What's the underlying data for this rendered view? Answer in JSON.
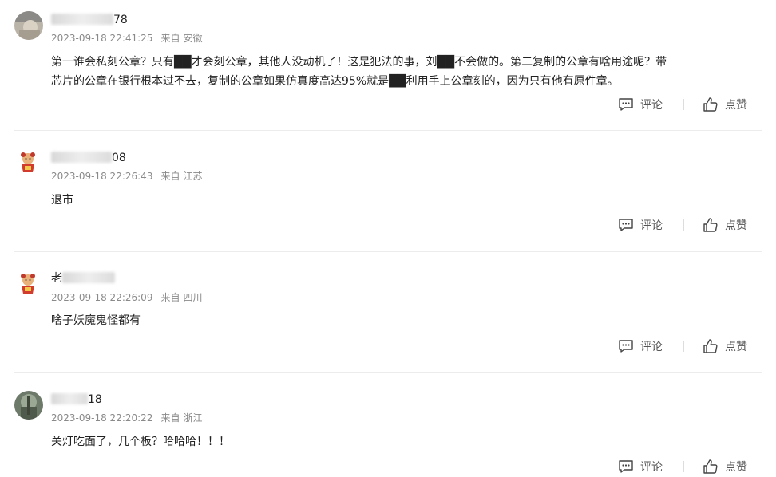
{
  "comments": [
    {
      "username_visible": "78",
      "time": "2023-09-18 22:41:25",
      "from_label": "来自",
      "location": "安徽",
      "content_line1": "第一谁会私刻公章？只有██才会刻公章，其他人没动机了！这是犯法的事，刘██不会做的。第二复制的公章有啥用途呢？带",
      "content_line2": "芯片的公章在银行根本过不去，复制的公章如果仿真度高达95%就是██利用手上公章刻的，因为只有他有原件章。",
      "comment_label": "评论",
      "like_label": "点赞"
    },
    {
      "username_visible": "08",
      "time": "2023-09-18 22:26:43",
      "from_label": "来自",
      "location": "江苏",
      "content": "退市",
      "comment_label": "评论",
      "like_label": "点赞"
    },
    {
      "username_visible": "老",
      "time": "2023-09-18 22:26:09",
      "from_label": "来自",
      "location": "四川",
      "content": "啥子妖魔鬼怪都有",
      "comment_label": "评论",
      "like_label": "点赞"
    },
    {
      "username_visible": "18",
      "time": "2023-09-18 22:20:22",
      "from_label": "来自",
      "location": "浙江",
      "content": "关灯吃面了，几个板？哈哈哈！！！",
      "comment_label": "评论",
      "like_label": "点赞"
    }
  ],
  "icons": {
    "comment": "comment-bubble-icon",
    "like": "thumbs-up-icon"
  },
  "colors": {
    "text": "#222222",
    "meta": "#8a8a8a",
    "action": "#555555",
    "divider": "#ececec"
  }
}
